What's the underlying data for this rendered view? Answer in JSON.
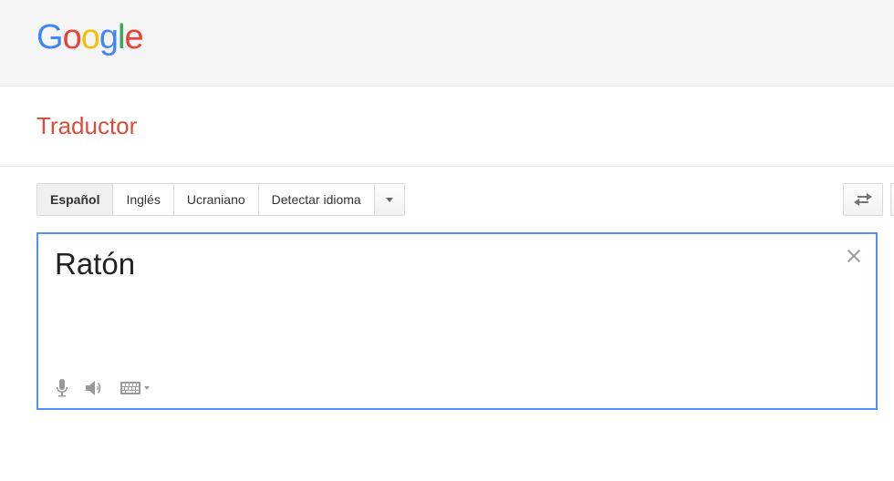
{
  "title": "Traductor",
  "source_langs": {
    "selected": "Español",
    "tab2": "Inglés",
    "tab3": "Ucraniano",
    "detect": "Detectar idioma"
  },
  "input_text": "Ratón"
}
